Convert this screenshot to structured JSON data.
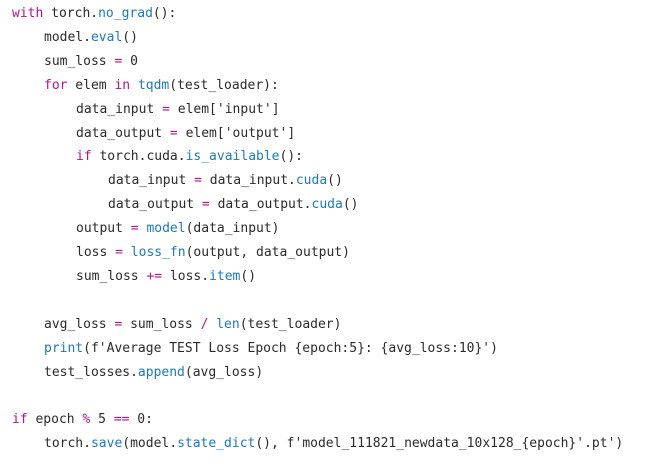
{
  "colors": {
    "background": "#ffffff",
    "text": "#2b2b2b",
    "keyword": "#b5128c",
    "function": "#1c78c0"
  },
  "lines": [
    {
      "indent": 0,
      "tokens": [
        [
          "kw",
          "with"
        ],
        [
          "plain",
          " torch."
        ],
        [
          "fn",
          "no_grad"
        ],
        [
          "plain",
          "():"
        ]
      ]
    },
    {
      "indent": 1,
      "tokens": [
        [
          "plain",
          "model."
        ],
        [
          "fn",
          "eval"
        ],
        [
          "plain",
          "()"
        ]
      ]
    },
    {
      "indent": 1,
      "tokens": [
        [
          "plain",
          "sum_loss "
        ],
        [
          "op",
          "="
        ],
        [
          "plain",
          " "
        ],
        [
          "num",
          "0"
        ]
      ]
    },
    {
      "indent": 1,
      "tokens": [
        [
          "kw",
          "for"
        ],
        [
          "plain",
          " elem "
        ],
        [
          "kw",
          "in"
        ],
        [
          "plain",
          " "
        ],
        [
          "fn",
          "tqdm"
        ],
        [
          "plain",
          "(test_loader):"
        ]
      ]
    },
    {
      "indent": 2,
      "tokens": [
        [
          "plain",
          "data_input "
        ],
        [
          "op",
          "="
        ],
        [
          "plain",
          " elem["
        ],
        [
          "str",
          "'input'"
        ],
        [
          "plain",
          "]"
        ]
      ]
    },
    {
      "indent": 2,
      "tokens": [
        [
          "plain",
          "data_output "
        ],
        [
          "op",
          "="
        ],
        [
          "plain",
          " elem["
        ],
        [
          "str",
          "'output'"
        ],
        [
          "plain",
          "]"
        ]
      ]
    },
    {
      "indent": 2,
      "tokens": [
        [
          "kw",
          "if"
        ],
        [
          "plain",
          " torch.cuda."
        ],
        [
          "fn",
          "is_available"
        ],
        [
          "plain",
          "():"
        ]
      ]
    },
    {
      "indent": 3,
      "tokens": [
        [
          "plain",
          "data_input "
        ],
        [
          "op",
          "="
        ],
        [
          "plain",
          " data_input."
        ],
        [
          "fn",
          "cuda"
        ],
        [
          "plain",
          "()"
        ]
      ]
    },
    {
      "indent": 3,
      "tokens": [
        [
          "plain",
          "data_output "
        ],
        [
          "op",
          "="
        ],
        [
          "plain",
          " data_output."
        ],
        [
          "fn",
          "cuda"
        ],
        [
          "plain",
          "()"
        ]
      ]
    },
    {
      "indent": 2,
      "tokens": [
        [
          "plain",
          "output "
        ],
        [
          "op",
          "="
        ],
        [
          "plain",
          " "
        ],
        [
          "fn",
          "model"
        ],
        [
          "plain",
          "(data_input)"
        ]
      ]
    },
    {
      "indent": 2,
      "tokens": [
        [
          "plain",
          "loss "
        ],
        [
          "op",
          "="
        ],
        [
          "plain",
          " "
        ],
        [
          "fn",
          "loss_fn"
        ],
        [
          "plain",
          "(output, data_output)"
        ]
      ]
    },
    {
      "indent": 2,
      "tokens": [
        [
          "plain",
          "sum_loss "
        ],
        [
          "op",
          "+="
        ],
        [
          "plain",
          " loss."
        ],
        [
          "fn",
          "item"
        ],
        [
          "plain",
          "()"
        ]
      ]
    },
    {
      "indent": 0,
      "tokens": []
    },
    {
      "indent": 1,
      "tokens": [
        [
          "plain",
          "avg_loss "
        ],
        [
          "op",
          "="
        ],
        [
          "plain",
          " sum_loss "
        ],
        [
          "op",
          "/"
        ],
        [
          "plain",
          " "
        ],
        [
          "fn",
          "len"
        ],
        [
          "plain",
          "(test_loader)"
        ]
      ]
    },
    {
      "indent": 1,
      "tokens": [
        [
          "fn",
          "print"
        ],
        [
          "plain",
          "("
        ],
        [
          "str",
          "f'Average TEST Loss Epoch {epoch:5}: {avg_loss:10}'"
        ],
        [
          "plain",
          ")"
        ]
      ]
    },
    {
      "indent": 1,
      "tokens": [
        [
          "plain",
          "test_losses."
        ],
        [
          "fn",
          "append"
        ],
        [
          "plain",
          "(avg_loss)"
        ]
      ]
    },
    {
      "indent": 0,
      "tokens": []
    },
    {
      "indent": 0,
      "tokens": [
        [
          "kw",
          "if"
        ],
        [
          "plain",
          " epoch "
        ],
        [
          "op",
          "%"
        ],
        [
          "plain",
          " "
        ],
        [
          "num",
          "5"
        ],
        [
          "plain",
          " "
        ],
        [
          "op",
          "=="
        ],
        [
          "plain",
          " "
        ],
        [
          "num",
          "0"
        ],
        [
          "plain",
          ":"
        ]
      ]
    },
    {
      "indent": 1,
      "tokens": [
        [
          "plain",
          "torch."
        ],
        [
          "fn",
          "save"
        ],
        [
          "plain",
          "(model."
        ],
        [
          "fn",
          "state_dict"
        ],
        [
          "plain",
          "(), "
        ],
        [
          "str",
          "f'model_111821_newdata_10x128_{epoch}'"
        ],
        [
          "plain",
          "."
        ],
        [
          "str",
          "pt'"
        ],
        [
          "plain",
          ")"
        ]
      ]
    }
  ]
}
